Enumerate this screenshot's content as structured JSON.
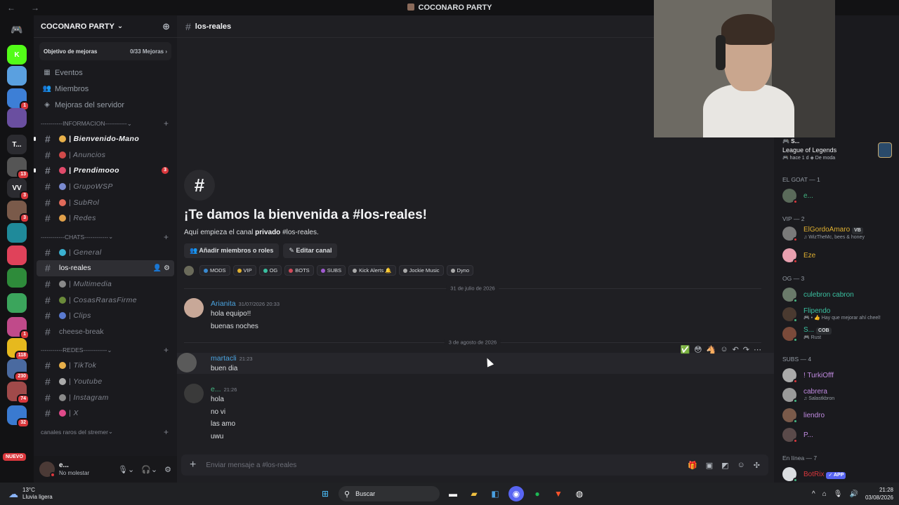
{
  "window": {
    "title": "COCONARO PARTY",
    "back": "←",
    "forward": "→"
  },
  "servers": [
    {
      "icon": "discord-icon",
      "label": "",
      "color": "#5865f2",
      "badge": ""
    },
    {
      "icon": "kick-icon",
      "label": "K",
      "color": "#53fc18",
      "badge": ""
    },
    {
      "icon": "uruguay-icon",
      "label": "",
      "color": "#5aa0e0",
      "badge": ""
    },
    {
      "icon": "server-icon",
      "label": "",
      "color": "#3d7fd6",
      "badge": "1"
    },
    {
      "icon": "server-icon",
      "label": "",
      "color": "#6a4fa0",
      "badge": ""
    },
    {
      "icon": "server-icon",
      "label": "T...",
      "color": "#2b2b30",
      "badge": ""
    },
    {
      "icon": "server-icon",
      "label": "",
      "color": "#555",
      "badge": "13"
    },
    {
      "icon": "server-icon",
      "label": "VV",
      "color": "#2b2b30",
      "badge": "3"
    },
    {
      "icon": "server-icon",
      "label": "",
      "color": "#7a5a4a",
      "badge": "3"
    },
    {
      "icon": "server-icon",
      "label": "",
      "color": "#1f8a9a",
      "badge": ""
    },
    {
      "icon": "server-icon",
      "label": "",
      "color": "#e0425a",
      "badge": ""
    },
    {
      "icon": "server-icon",
      "label": "",
      "color": "#2e8b3a",
      "badge": ""
    },
    {
      "icon": "folder-icon",
      "label": "",
      "color": "#3ba55c",
      "badge": ""
    },
    {
      "icon": "server-icon",
      "label": "",
      "color": "#c04a8a",
      "badge": "1"
    },
    {
      "icon": "server-icon",
      "label": "",
      "color": "#e6b91e",
      "badge": "118"
    },
    {
      "icon": "server-icon",
      "label": "",
      "color": "#4a6aa0",
      "badge": "230"
    },
    {
      "icon": "server-icon",
      "label": "",
      "color": "#a04a4a",
      "badge": "74"
    },
    {
      "icon": "server-icon",
      "label": "",
      "color": "#3a7ad0",
      "badge": "32"
    }
  ],
  "servers_new": "NUEVO",
  "guild": {
    "name": "COCONARO PARTY",
    "boost_label": "Objetivo de mejoras",
    "boost_count": "0/33 Mejoras"
  },
  "nav": [
    {
      "icon": "calendar-icon",
      "glyph": "▦",
      "label": "Eventos"
    },
    {
      "icon": "members-icon",
      "glyph": "👥",
      "label": "Miembros"
    },
    {
      "icon": "boost-icon",
      "glyph": "◈",
      "label": "Mejoras del servidor"
    }
  ],
  "categories": {
    "info": "-----------INFORMACION-----------",
    "chats": "------------CHATS------------",
    "redes": "-----------REDES------------",
    "raros": "canales raros del stremer"
  },
  "channels": {
    "info": [
      {
        "label": "| Bienvenido-Mano",
        "emoji": "#e8b04a",
        "unread": true,
        "badge": ""
      },
      {
        "label": "| Anuncios",
        "emoji": "#d04a4a",
        "unread": false,
        "badge": ""
      },
      {
        "label": "| Prendimooo",
        "emoji": "#e04a6a",
        "unread": true,
        "badge": "3"
      },
      {
        "label": "| GrupoWSP",
        "emoji": "#7a8ad0",
        "unread": false,
        "badge": ""
      },
      {
        "label": "| SubRol",
        "emoji": "#e06a5a",
        "unread": false,
        "badge": ""
      },
      {
        "label": "| Redes",
        "emoji": "#e0a04a",
        "unread": false,
        "badge": ""
      }
    ],
    "chats": [
      {
        "label": "| General",
        "emoji": "#3ab0d0",
        "active": false
      },
      {
        "label": "los-reales",
        "emoji": "",
        "active": true
      },
      {
        "label": "| Multimedia",
        "emoji": "#8a8a8a",
        "active": false
      },
      {
        "label": "| CosasRarasFirme",
        "emoji": "#6a8a3a",
        "active": false
      },
      {
        "label": "| Clips",
        "emoji": "#5a7ad0",
        "active": false
      },
      {
        "label": "cheese-break",
        "emoji": "",
        "active": false
      }
    ],
    "redes": [
      {
        "label": "| TikTok",
        "emoji": "#e8b04a"
      },
      {
        "label": "| Youtube",
        "emoji": "#aaaaaa"
      },
      {
        "label": "| Instagram",
        "emoji": "#8a8a8a"
      },
      {
        "label": "| X",
        "emoji": "#e04a8a"
      }
    ]
  },
  "user": {
    "name": "e...",
    "status": "No molestar"
  },
  "channel_header": {
    "name": "los-reales"
  },
  "welcome": {
    "title": "¡Te damos la bienvenida a #los-reales!",
    "sub_pre": "Aquí empieza el canal ",
    "sub_bold": "privado",
    "sub_post": " #los-reales.",
    "btn_add": "Añadir miembros o roles",
    "btn_edit": "Editar canal"
  },
  "roles": [
    {
      "name": "MODS",
      "color": "#3a8ad0"
    },
    {
      "name": "VIP",
      "color": "#e0b030"
    },
    {
      "name": "OG",
      "color": "#3ac0a0"
    },
    {
      "name": "BOTS",
      "color": "#d04a5a"
    },
    {
      "name": "SUBS",
      "color": "#a05ad0"
    },
    {
      "name": "Kick Alerts 🔔",
      "color": "#aaaaaa"
    },
    {
      "name": "Jockie Music",
      "color": "#aaaaaa"
    },
    {
      "name": "Dyno",
      "color": "#aaaaaa"
    }
  ],
  "dates": {
    "d1": "31 de julio de 2026",
    "d2": "3 de agosto de 2026"
  },
  "messages": [
    {
      "author": "Arianita",
      "time": "31/07/2026 20:33",
      "lines": [
        "hola equipo!!",
        "buenas noches"
      ],
      "color": "blue"
    },
    {
      "author": "martacli",
      "time": "21:23",
      "lines": [
        "buen dia"
      ],
      "color": "blue"
    },
    {
      "author": "e...",
      "time": "21:26",
      "lines": [
        "hola",
        "no vi",
        "las amo",
        "uwu"
      ],
      "color": "green"
    }
  ],
  "composer": {
    "placeholder": "Enviar mensaje a #los-reales"
  },
  "members_panel": {
    "activity": {
      "name": "S...",
      "game": "League of Legends",
      "meta": "🎮 hace 1 d   ◈ De moda"
    },
    "cats": [
      "EL GOAT — 1",
      "VIP — 2",
      "OG — 3",
      "SUBS — 4",
      "En línea — 7"
    ],
    "members": [
      {
        "name": "e...",
        "sub": "",
        "tag": "",
        "color": "#43b581",
        "avatar": "#5a6a5a",
        "status": "#da373c"
      },
      {
        "name": "ElGordoAmaro",
        "sub": "♫ WizTheMc, bees & honey",
        "tag": "VB",
        "color": "#e0b030",
        "avatar": "#7a7a7a",
        "status": "#da373c"
      },
      {
        "name": "Eze",
        "sub": "",
        "tag": "",
        "color": "#e0b030",
        "avatar": "#e8a0b0",
        "status": "#da373c"
      },
      {
        "name": "culebron cabron",
        "sub": "",
        "tag": "",
        "color": "#3ac0a0",
        "avatar": "#6a7a6a",
        "status": "#43b581"
      },
      {
        "name": "Flipendo",
        "sub": "🎮 • 👍  Hay que mejorar ahí cheel!",
        "tag": "",
        "color": "#3ac0a0",
        "avatar": "#4a3a30",
        "status": "#43b581"
      },
      {
        "name": "S...",
        "sub": "🎮 Rust",
        "tag": "COB",
        "color": "#3ac0a0",
        "avatar": "#7a4a3a",
        "status": "#43b581"
      },
      {
        "name": "! TurkiOfff",
        "sub": "",
        "tag": "",
        "color": "#c08ae0",
        "avatar": "#aaaaaa",
        "status": "#da373c"
      },
      {
        "name": "cabrera",
        "sub": "♫ Salastkbron",
        "tag": "",
        "color": "#c08ae0",
        "avatar": "#9a9a9a",
        "status": "#43b581"
      },
      {
        "name": "liendro",
        "sub": "",
        "tag": "",
        "color": "#c08ae0",
        "avatar": "#7a5a4a",
        "status": "#43b581"
      },
      {
        "name": "P...",
        "sub": "",
        "tag": "",
        "color": "#c08ae0",
        "avatar": "#5a4a4a",
        "status": "#da373c"
      },
      {
        "name": "BotRix",
        "sub": "",
        "tag": "✓ APP",
        "color": "#da373c",
        "avatar": "#dbdee1",
        "status": "#43b581"
      }
    ]
  },
  "taskbar": {
    "temp": "13°C",
    "weather": "Lluvia ligera",
    "search": "Buscar",
    "time": "21:28",
    "date": "03/08/2026"
  }
}
